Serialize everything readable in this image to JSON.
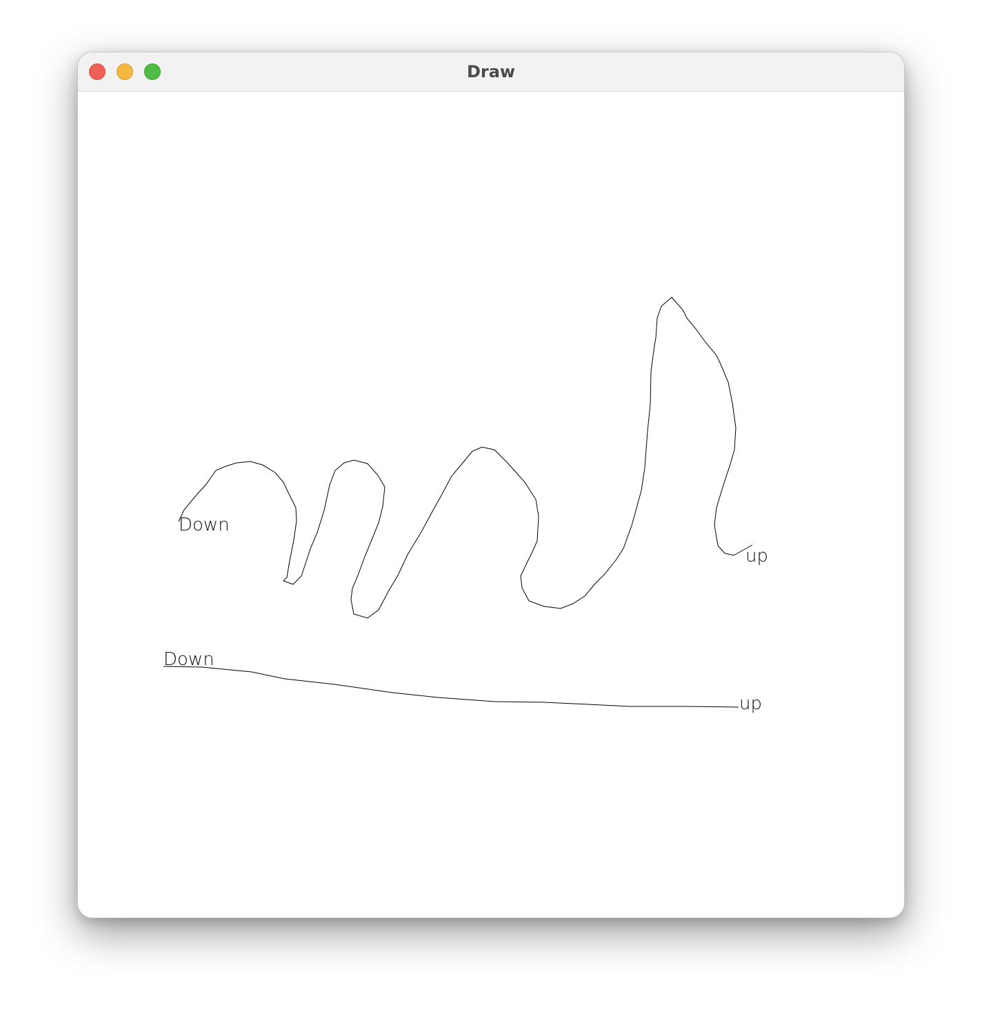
{
  "window": {
    "title": "Draw",
    "buttons": [
      "close",
      "minimize",
      "zoom"
    ]
  },
  "canvas": {
    "strokes": [
      {
        "start_label": "Down",
        "end_label": "up"
      },
      {
        "start_label": "Down",
        "end_label": "up"
      }
    ]
  },
  "colors": {
    "close": "#ee5f57",
    "minimize": "#f4b73f",
    "zoom": "#4fbd44",
    "stroke": "#000000",
    "titlebar": "#f1f2f1"
  }
}
